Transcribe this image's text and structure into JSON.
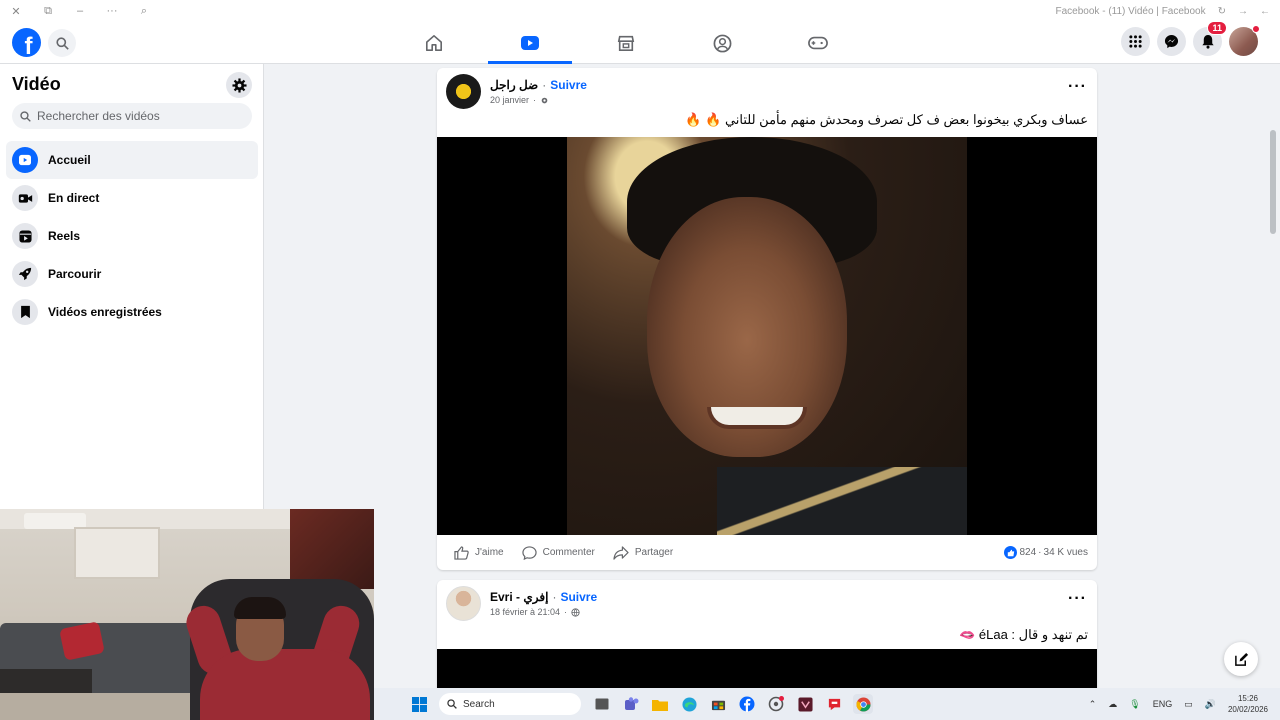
{
  "window": {
    "title": "Facebook - (11) Vidéo | Facebook",
    "controls": [
      "close",
      "restore",
      "minimize",
      "more",
      "extension"
    ]
  },
  "header": {
    "logo": "f",
    "nav": [
      {
        "name": "home",
        "active": false
      },
      {
        "name": "video",
        "active": true
      },
      {
        "name": "marketplace",
        "active": false
      },
      {
        "name": "groups",
        "active": false
      },
      {
        "name": "gaming",
        "active": false
      }
    ],
    "notification_count": "11"
  },
  "sidebar": {
    "title": "Vidéo",
    "search_placeholder": "Rechercher des vidéos",
    "items": [
      {
        "label": "Accueil",
        "icon": "play-icon",
        "active": true
      },
      {
        "label": "En direct",
        "icon": "live-camera-icon",
        "active": false
      },
      {
        "label": "Reels",
        "icon": "reels-icon",
        "active": false
      },
      {
        "label": "Parcourir",
        "icon": "rocket-icon",
        "active": false
      },
      {
        "label": "Vidéos enregistrées",
        "icon": "bookmark-icon",
        "active": false
      }
    ]
  },
  "posts": [
    {
      "author": "ضل راجل",
      "follow": "Suivre",
      "date": "20 janvier",
      "text": "عساف وبكري بيخونوا بعض ف كل تصرف ومحدش منهم مأمن للتاني 🔥 🔥",
      "actions": {
        "like": "J'aime",
        "comment": "Commenter",
        "share": "Partager"
      },
      "reactions": "824",
      "views": "34 K vues"
    },
    {
      "author": "Evri - إفري",
      "follow": "Suivre",
      "date": "18 février à 21:04",
      "text": "تم تنهد و قال : éLaa 🫦"
    }
  ],
  "taskbar": {
    "search": "Search",
    "lang": "ENG",
    "time": "15:26",
    "date": "20/02/2026"
  },
  "colors": {
    "brand": "#0866ff",
    "background": "#f0f2f5",
    "badge": "#e41e3f"
  }
}
